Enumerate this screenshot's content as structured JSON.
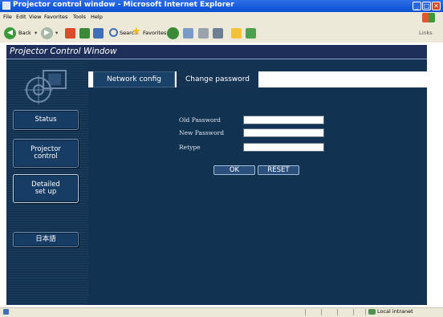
{
  "window": {
    "title": "Projector control window - Microsoft Internet Explorer"
  },
  "menu": {
    "items": [
      "File",
      "Edit",
      "View",
      "Favorites",
      "Tools",
      "Help"
    ]
  },
  "toolbar": {
    "back_label": "Back",
    "search_label": "Search",
    "favorites_label": "Favorites",
    "links_label": "Links"
  },
  "banner": {
    "title": "Projector Control Window"
  },
  "sidebar": {
    "items": [
      {
        "label": "Status"
      },
      {
        "line1": "Projector",
        "line2": "control"
      },
      {
        "line1": "Detailed",
        "line2": "set up"
      },
      {
        "label": "日本語"
      }
    ]
  },
  "tabs": [
    {
      "label": "Network config"
    },
    {
      "label": "Change password"
    }
  ],
  "form": {
    "old_password_label": "Old Password",
    "new_password_label": "New Password",
    "retype_label": "Retype",
    "old_password_value": "",
    "new_password_value": "",
    "retype_value": "",
    "ok_label": "OK",
    "reset_label": "RESET"
  },
  "statusbar": {
    "zone": "Local intranet"
  },
  "colors": {
    "banner": "#1e2f5a",
    "nav_bg": "#123251",
    "content_bg": "#143252",
    "titlebar": "#0a4fd2"
  }
}
